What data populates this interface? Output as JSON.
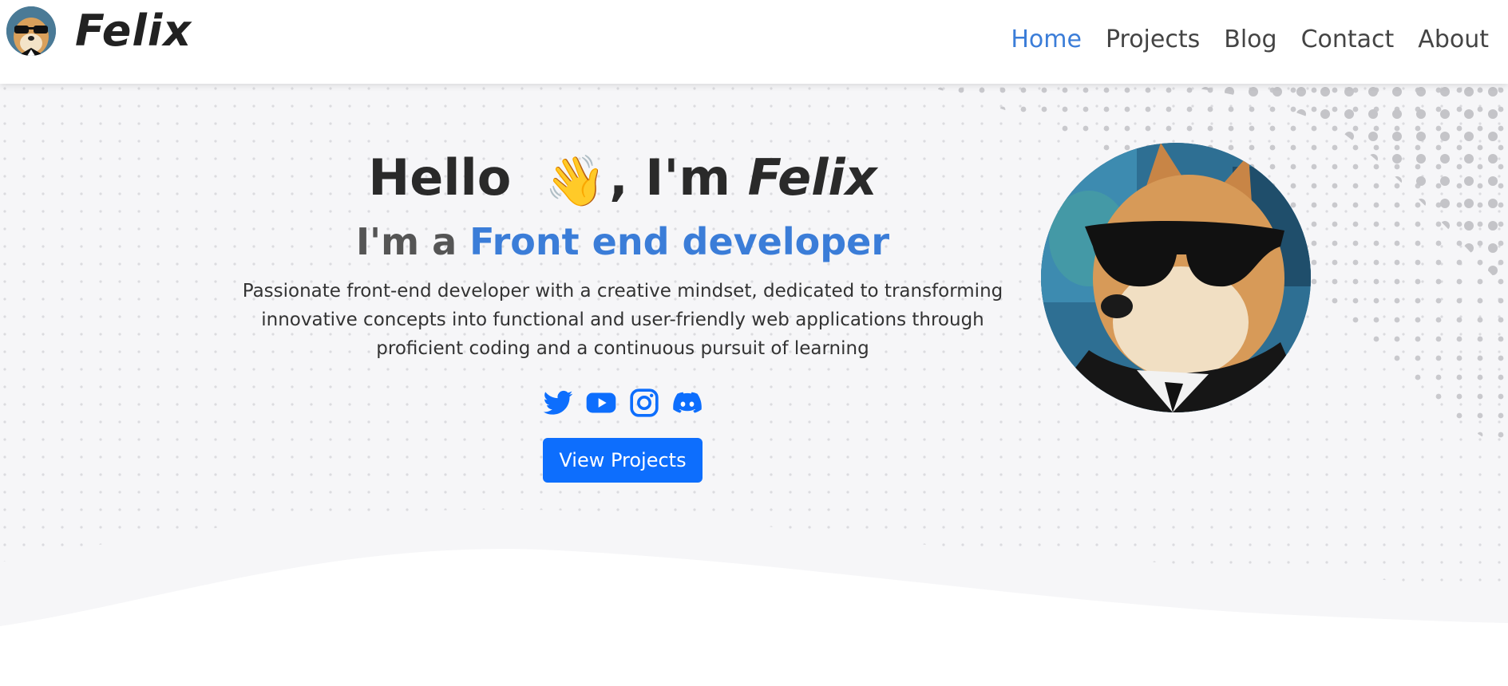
{
  "brand": {
    "name": "Felix",
    "logo_icon": "doge-avatar-icon"
  },
  "nav": {
    "items": [
      {
        "label": "Home",
        "active": true
      },
      {
        "label": "Projects",
        "active": false
      },
      {
        "label": "Blog",
        "active": false
      },
      {
        "label": "Contact",
        "active": false
      },
      {
        "label": "About",
        "active": false
      }
    ]
  },
  "hero": {
    "greeting_prefix": "Hello",
    "greeting_emoji": "👋",
    "greeting_suffix": ", I'm",
    "greeting_name": "Felix",
    "role_prefix": "I'm a",
    "role_highlight": "Front end developer",
    "description": "Passionate front-end developer with a creative mindset, dedicated to transforming innovative concepts into functional and user-friendly web applications through proficient coding and a continuous pursuit of learning",
    "socials": [
      {
        "icon": "twitter-icon"
      },
      {
        "icon": "youtube-icon"
      },
      {
        "icon": "instagram-icon"
      },
      {
        "icon": "discord-icon"
      }
    ],
    "cta_label": "View Projects",
    "portrait_icon": "doge-sunglasses-portrait"
  },
  "colors": {
    "accent": "#3b7dd8",
    "button": "#0d6efd",
    "hero_bg": "#f6f6f8",
    "dots": "#c4c4c8"
  }
}
